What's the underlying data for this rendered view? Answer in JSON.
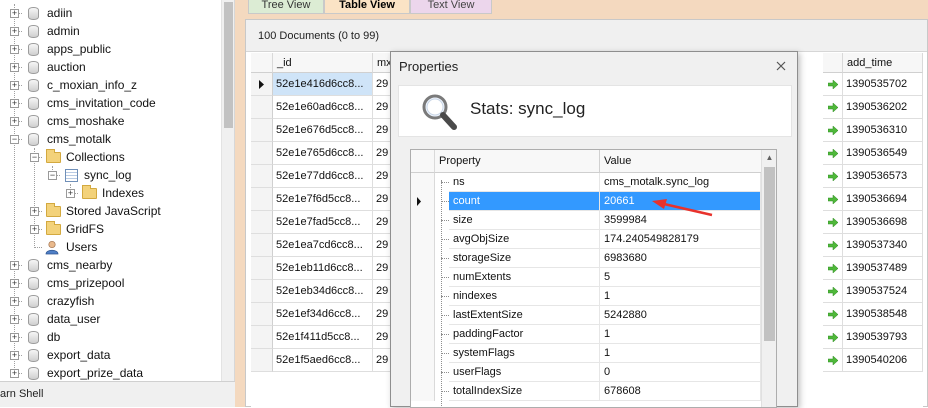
{
  "tree": {
    "databases": [
      {
        "label": "adiin"
      },
      {
        "label": "admin"
      },
      {
        "label": "apps_public"
      },
      {
        "label": "auction"
      },
      {
        "label": "c_moxian_info_z"
      },
      {
        "label": "cms_invitation_code"
      },
      {
        "label": "cms_moshake"
      },
      {
        "label": "cms_motalk"
      },
      {
        "label": "cms_nearby"
      },
      {
        "label": "cms_prizepool"
      },
      {
        "label": "crazyfish"
      },
      {
        "label": "data_user"
      },
      {
        "label": "db"
      },
      {
        "label": "export_data"
      },
      {
        "label": "export_prize_data"
      }
    ],
    "expanded": {
      "collections_label": "Collections",
      "collection_label": "sync_log",
      "indexes_label": "Indexes",
      "stored_js_label": "Stored JavaScript",
      "gridfs_label": "GridFS",
      "users_label": "Users"
    }
  },
  "statusbar": {
    "text": "arn Shell"
  },
  "tabs": [
    {
      "label": "Tree View"
    },
    {
      "label": "Table View"
    },
    {
      "label": "Text View"
    }
  ],
  "grid": {
    "doc_count": "100 Documents (0 to 99)",
    "columns": {
      "id": "_id",
      "mx": "mx",
      "add_time": "add_time"
    },
    "rows": [
      {
        "id": "52e1e416d6cc8...",
        "mx": "29",
        "add_time": "1390535702"
      },
      {
        "id": "52e1e60ad6cc8...",
        "mx": "29",
        "add_time": "1390536202"
      },
      {
        "id": "52e1e676d5cc8...",
        "mx": "29",
        "add_time": "1390536310"
      },
      {
        "id": "52e1e765d6cc8...",
        "mx": "29",
        "add_time": "1390536549"
      },
      {
        "id": "52e1e77dd6cc8...",
        "mx": "29",
        "add_time": "1390536573"
      },
      {
        "id": "52e1e7f6d5cc8...",
        "mx": "29",
        "add_time": "1390536694"
      },
      {
        "id": "52e1e7fad5cc8...",
        "mx": "29",
        "add_time": "1390536698"
      },
      {
        "id": "52e1ea7cd6cc8...",
        "mx": "29",
        "add_time": "1390537340"
      },
      {
        "id": "52e1eb11d6cc8...",
        "mx": "29",
        "add_time": "1390537489"
      },
      {
        "id": "52e1eb34d6cc8...",
        "mx": "29",
        "add_time": "1390537524"
      },
      {
        "id": "52e1ef34d6cc8...",
        "mx": "29",
        "add_time": "1390538548"
      },
      {
        "id": "52e1f411d5cc8...",
        "mx": "29",
        "add_time": "1390539793"
      },
      {
        "id": "52e1f5aed6cc8...",
        "mx": "29",
        "add_time": "1390540206"
      }
    ]
  },
  "properties": {
    "title": "Properties",
    "header": "Stats: sync_log",
    "col_property": "Property",
    "col_value": "Value",
    "rows": [
      {
        "name": "ns",
        "value": "cms_motalk.sync_log"
      },
      {
        "name": "count",
        "value": "20661"
      },
      {
        "name": "size",
        "value": "3599984"
      },
      {
        "name": "avgObjSize",
        "value": "174.240549828179"
      },
      {
        "name": "storageSize",
        "value": "6983680"
      },
      {
        "name": "numExtents",
        "value": "5"
      },
      {
        "name": "nindexes",
        "value": "1"
      },
      {
        "name": "lastExtentSize",
        "value": "5242880"
      },
      {
        "name": "paddingFactor",
        "value": "1"
      },
      {
        "name": "systemFlags",
        "value": "1"
      },
      {
        "name": "userFlags",
        "value": "0"
      },
      {
        "name": "totalIndexSize",
        "value": "678608"
      }
    ]
  },
  "colors": {
    "accent_selected": "#3399ff",
    "tab_table": "#fbe3c5",
    "annotation_arrow": "#e8322c"
  }
}
